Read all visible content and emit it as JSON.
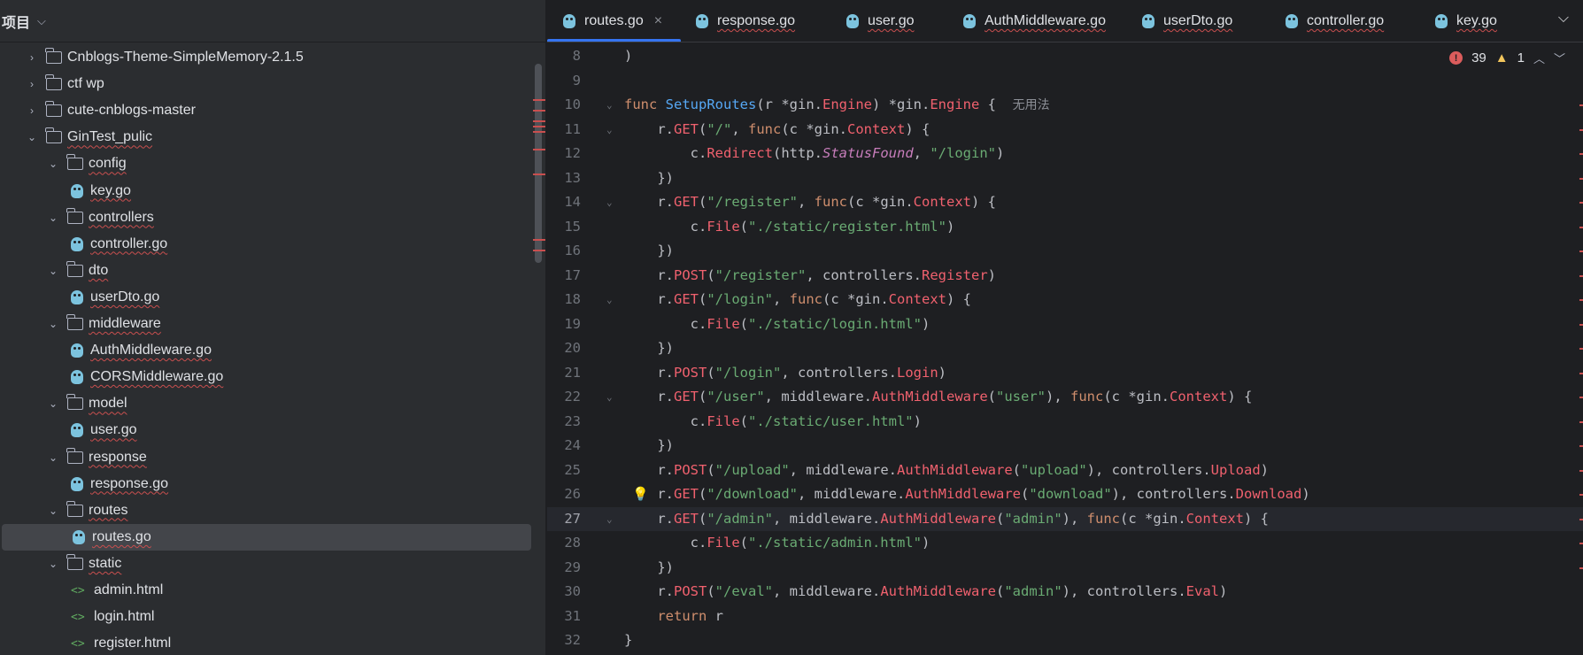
{
  "sidebar": {
    "title": "项目",
    "tree": [
      {
        "label": "Cnblogs-Theme-SimpleMemory-2.1.5",
        "type": "folder",
        "expanded": false,
        "depth": 0
      },
      {
        "label": "ctf wp",
        "type": "folder",
        "expanded": false,
        "depth": 0
      },
      {
        "label": "cute-cnblogs-master",
        "type": "folder",
        "expanded": false,
        "depth": 0
      },
      {
        "label": "GinTest_pulic",
        "type": "folder",
        "expanded": true,
        "depth": 0
      },
      {
        "label": "config",
        "type": "folder",
        "expanded": true,
        "depth": 1
      },
      {
        "label": "key.go",
        "type": "go",
        "depth": 2
      },
      {
        "label": "controllers",
        "type": "folder",
        "expanded": true,
        "depth": 1
      },
      {
        "label": "controller.go",
        "type": "go",
        "depth": 2
      },
      {
        "label": "dto",
        "type": "folder",
        "expanded": true,
        "depth": 1
      },
      {
        "label": "userDto.go",
        "type": "go",
        "depth": 2
      },
      {
        "label": "middleware",
        "type": "folder",
        "expanded": true,
        "depth": 1
      },
      {
        "label": "AuthMiddleware.go",
        "type": "go",
        "depth": 2
      },
      {
        "label": "CORSMiddleware.go",
        "type": "go",
        "depth": 2
      },
      {
        "label": "model",
        "type": "folder",
        "expanded": true,
        "depth": 1
      },
      {
        "label": "user.go",
        "type": "go",
        "depth": 2
      },
      {
        "label": "response",
        "type": "folder",
        "expanded": true,
        "depth": 1
      },
      {
        "label": "response.go",
        "type": "go",
        "depth": 2
      },
      {
        "label": "routes",
        "type": "folder",
        "expanded": true,
        "depth": 1
      },
      {
        "label": "routes.go",
        "type": "go",
        "depth": 2,
        "selected": true
      },
      {
        "label": "static",
        "type": "folder",
        "expanded": true,
        "depth": 1
      },
      {
        "label": "admin.html",
        "type": "html",
        "depth": 2
      },
      {
        "label": "login.html",
        "type": "html",
        "depth": 2
      },
      {
        "label": "register.html",
        "type": "html",
        "depth": 2
      }
    ]
  },
  "tabs": [
    {
      "label": "routes.go",
      "active": true
    },
    {
      "label": "response.go"
    },
    {
      "label": "user.go"
    },
    {
      "label": "AuthMiddleware.go"
    },
    {
      "label": "userDto.go"
    },
    {
      "label": "controller.go"
    },
    {
      "label": "key.go"
    }
  ],
  "inspections": {
    "errors": "39",
    "warnings": "1"
  },
  "editor": {
    "current_line": 27,
    "usage_hint": "无用法",
    "lines": [
      {
        "n": "8",
        "tokens": [
          [
            "",
            ")"
          ]
        ]
      },
      {
        "n": "9",
        "tokens": []
      },
      {
        "n": "10",
        "fold": true,
        "tokens": [
          [
            "kw",
            "func "
          ],
          [
            "fn",
            "SetupRoutes"
          ],
          [
            "",
            "(r *"
          ],
          [
            "pkg",
            "gin"
          ],
          [
            "",
            "."
          ],
          [
            "typ",
            "Engine"
          ],
          [
            "",
            ") *"
          ],
          [
            "pkg",
            "gin"
          ],
          [
            "",
            "."
          ],
          [
            "typ",
            "Engine"
          ],
          [
            "",
            " {  "
          ],
          [
            "hint",
            "无用法"
          ]
        ]
      },
      {
        "n": "11",
        "fold": true,
        "tokens": [
          [
            "",
            "    r."
          ],
          [
            "meth",
            "GET"
          ],
          [
            "",
            "("
          ],
          [
            "str",
            "\"/\""
          ],
          [
            "",
            ", "
          ],
          [
            "kw",
            "func"
          ],
          [
            "",
            "(c *"
          ],
          [
            "pkg",
            "gin"
          ],
          [
            "",
            "."
          ],
          [
            "typ",
            "Context"
          ],
          [
            "",
            ") {"
          ]
        ]
      },
      {
        "n": "12",
        "tokens": [
          [
            "",
            "        c."
          ],
          [
            "meth",
            "Redirect"
          ],
          [
            "",
            "("
          ],
          [
            "pkg",
            "http"
          ],
          [
            "",
            "."
          ],
          [
            "const",
            "StatusFound"
          ],
          [
            "",
            ", "
          ],
          [
            "str",
            "\"/login\""
          ],
          [
            "",
            ")"
          ]
        ]
      },
      {
        "n": "13",
        "tokens": [
          [
            "",
            "    })"
          ]
        ]
      },
      {
        "n": "14",
        "fold": true,
        "tokens": [
          [
            "",
            "    r."
          ],
          [
            "meth",
            "GET"
          ],
          [
            "",
            "("
          ],
          [
            "str",
            "\"/register\""
          ],
          [
            "",
            ", "
          ],
          [
            "kw",
            "func"
          ],
          [
            "",
            "(c *"
          ],
          [
            "pkg",
            "gin"
          ],
          [
            "",
            "."
          ],
          [
            "typ",
            "Context"
          ],
          [
            "",
            ") {"
          ]
        ]
      },
      {
        "n": "15",
        "tokens": [
          [
            "",
            "        c."
          ],
          [
            "meth",
            "File"
          ],
          [
            "",
            "("
          ],
          [
            "str",
            "\"./static/register.html\""
          ],
          [
            "",
            ")"
          ]
        ]
      },
      {
        "n": "16",
        "tokens": [
          [
            "",
            "    })"
          ]
        ]
      },
      {
        "n": "17",
        "tokens": [
          [
            "",
            "    r."
          ],
          [
            "meth",
            "POST"
          ],
          [
            "",
            "("
          ],
          [
            "str",
            "\"/register\""
          ],
          [
            "",
            ", "
          ],
          [
            "pkg",
            "controllers"
          ],
          [
            "",
            "."
          ],
          [
            "meth",
            "Register"
          ],
          [
            "",
            ")"
          ]
        ]
      },
      {
        "n": "18",
        "fold": true,
        "tokens": [
          [
            "",
            "    r."
          ],
          [
            "meth",
            "GET"
          ],
          [
            "",
            "("
          ],
          [
            "str",
            "\"/login\""
          ],
          [
            "",
            ", "
          ],
          [
            "kw",
            "func"
          ],
          [
            "",
            "(c *"
          ],
          [
            "pkg",
            "gin"
          ],
          [
            "",
            "."
          ],
          [
            "typ",
            "Context"
          ],
          [
            "",
            ") {"
          ]
        ]
      },
      {
        "n": "19",
        "tokens": [
          [
            "",
            "        c."
          ],
          [
            "meth",
            "File"
          ],
          [
            "",
            "("
          ],
          [
            "str",
            "\"./static/login.html\""
          ],
          [
            "",
            ")"
          ]
        ]
      },
      {
        "n": "20",
        "tokens": [
          [
            "",
            "    })"
          ]
        ]
      },
      {
        "n": "21",
        "tokens": [
          [
            "",
            "    r."
          ],
          [
            "meth",
            "POST"
          ],
          [
            "",
            "("
          ],
          [
            "str",
            "\"/login\""
          ],
          [
            "",
            ", "
          ],
          [
            "pkg",
            "controllers"
          ],
          [
            "",
            "."
          ],
          [
            "meth",
            "Login"
          ],
          [
            "",
            ")"
          ]
        ]
      },
      {
        "n": "22",
        "fold": true,
        "tokens": [
          [
            "",
            "    r."
          ],
          [
            "meth",
            "GET"
          ],
          [
            "",
            "("
          ],
          [
            "str",
            "\"/user\""
          ],
          [
            "",
            ", "
          ],
          [
            "pkg",
            "middleware"
          ],
          [
            "",
            "."
          ],
          [
            "meth",
            "AuthMiddleware"
          ],
          [
            "",
            "("
          ],
          [
            "str",
            "\"user\""
          ],
          [
            "",
            "), "
          ],
          [
            "kw",
            "func"
          ],
          [
            "",
            "(c *"
          ],
          [
            "pkg",
            "gin"
          ],
          [
            "",
            "."
          ],
          [
            "typ",
            "Context"
          ],
          [
            "",
            ") {"
          ]
        ]
      },
      {
        "n": "23",
        "tokens": [
          [
            "",
            "        c."
          ],
          [
            "meth",
            "File"
          ],
          [
            "",
            "("
          ],
          [
            "str",
            "\"./static/user.html\""
          ],
          [
            "",
            ")"
          ]
        ]
      },
      {
        "n": "24",
        "tokens": [
          [
            "",
            "    })"
          ]
        ]
      },
      {
        "n": "25",
        "tokens": [
          [
            "",
            "    r."
          ],
          [
            "meth",
            "POST"
          ],
          [
            "",
            "("
          ],
          [
            "str",
            "\"/upload\""
          ],
          [
            "",
            ", "
          ],
          [
            "pkg",
            "middleware"
          ],
          [
            "",
            "."
          ],
          [
            "meth",
            "AuthMiddleware"
          ],
          [
            "",
            "("
          ],
          [
            "str",
            "\"upload\""
          ],
          [
            "",
            "), "
          ],
          [
            "pkg",
            "controllers"
          ],
          [
            "",
            "."
          ],
          [
            "meth",
            "Upload"
          ],
          [
            "",
            ")"
          ]
        ]
      },
      {
        "n": "26",
        "bulb": true,
        "tokens": [
          [
            "",
            "    r."
          ],
          [
            "meth",
            "GET"
          ],
          [
            "",
            "("
          ],
          [
            "str",
            "\"/download\""
          ],
          [
            "",
            ", "
          ],
          [
            "pkg",
            "middleware"
          ],
          [
            "",
            "."
          ],
          [
            "meth",
            "AuthMiddleware"
          ],
          [
            "",
            "("
          ],
          [
            "str",
            "\"download\""
          ],
          [
            "",
            "), "
          ],
          [
            "pkg",
            "controllers"
          ],
          [
            "",
            "."
          ],
          [
            "meth",
            "Download"
          ],
          [
            "",
            ")"
          ]
        ]
      },
      {
        "n": "27",
        "fold": true,
        "tokens": [
          [
            "",
            "    r."
          ],
          [
            "meth",
            "GET"
          ],
          [
            "",
            "("
          ],
          [
            "str",
            "\"/admin\""
          ],
          [
            "",
            ", "
          ],
          [
            "pkg",
            "middleware"
          ],
          [
            "",
            "."
          ],
          [
            "meth",
            "AuthMiddleware"
          ],
          [
            "",
            "("
          ],
          [
            "str",
            "\"admin\""
          ],
          [
            "",
            "), "
          ],
          [
            "kw",
            "func"
          ],
          [
            "",
            "(c *"
          ],
          [
            "pkg",
            "gin"
          ],
          [
            "",
            "."
          ],
          [
            "typ",
            "Context"
          ],
          [
            "",
            ") {"
          ]
        ]
      },
      {
        "n": "28",
        "tokens": [
          [
            "",
            "        c."
          ],
          [
            "meth",
            "File"
          ],
          [
            "",
            "("
          ],
          [
            "str",
            "\"./static/admin.html\""
          ],
          [
            "",
            ")"
          ]
        ]
      },
      {
        "n": "29",
        "tokens": [
          [
            "",
            "    })"
          ]
        ]
      },
      {
        "n": "30",
        "tokens": [
          [
            "",
            "    r."
          ],
          [
            "meth",
            "POST"
          ],
          [
            "",
            "("
          ],
          [
            "str",
            "\"/eval\""
          ],
          [
            "",
            ", "
          ],
          [
            "pkg",
            "middleware"
          ],
          [
            "",
            "."
          ],
          [
            "meth",
            "AuthMiddleware"
          ],
          [
            "",
            "("
          ],
          [
            "str",
            "\"admin\""
          ],
          [
            "",
            "), "
          ],
          [
            "pkg",
            "controllers"
          ],
          [
            "",
            "."
          ],
          [
            "meth",
            "Eval"
          ],
          [
            "",
            ")"
          ]
        ]
      },
      {
        "n": "31",
        "tokens": [
          [
            "",
            "    "
          ],
          [
            "kw",
            "return"
          ],
          [
            "",
            " r"
          ]
        ]
      },
      {
        "n": "32",
        "tokens": [
          [
            "",
            "}"
          ]
        ]
      }
    ]
  },
  "colors": {
    "accent": "#3574f0",
    "error": "#db5c5c",
    "warning": "#f2c55c"
  },
  "icons": {
    "go_file": "gopher-icon",
    "html_file": "html-icon",
    "folder": "folder-icon"
  }
}
